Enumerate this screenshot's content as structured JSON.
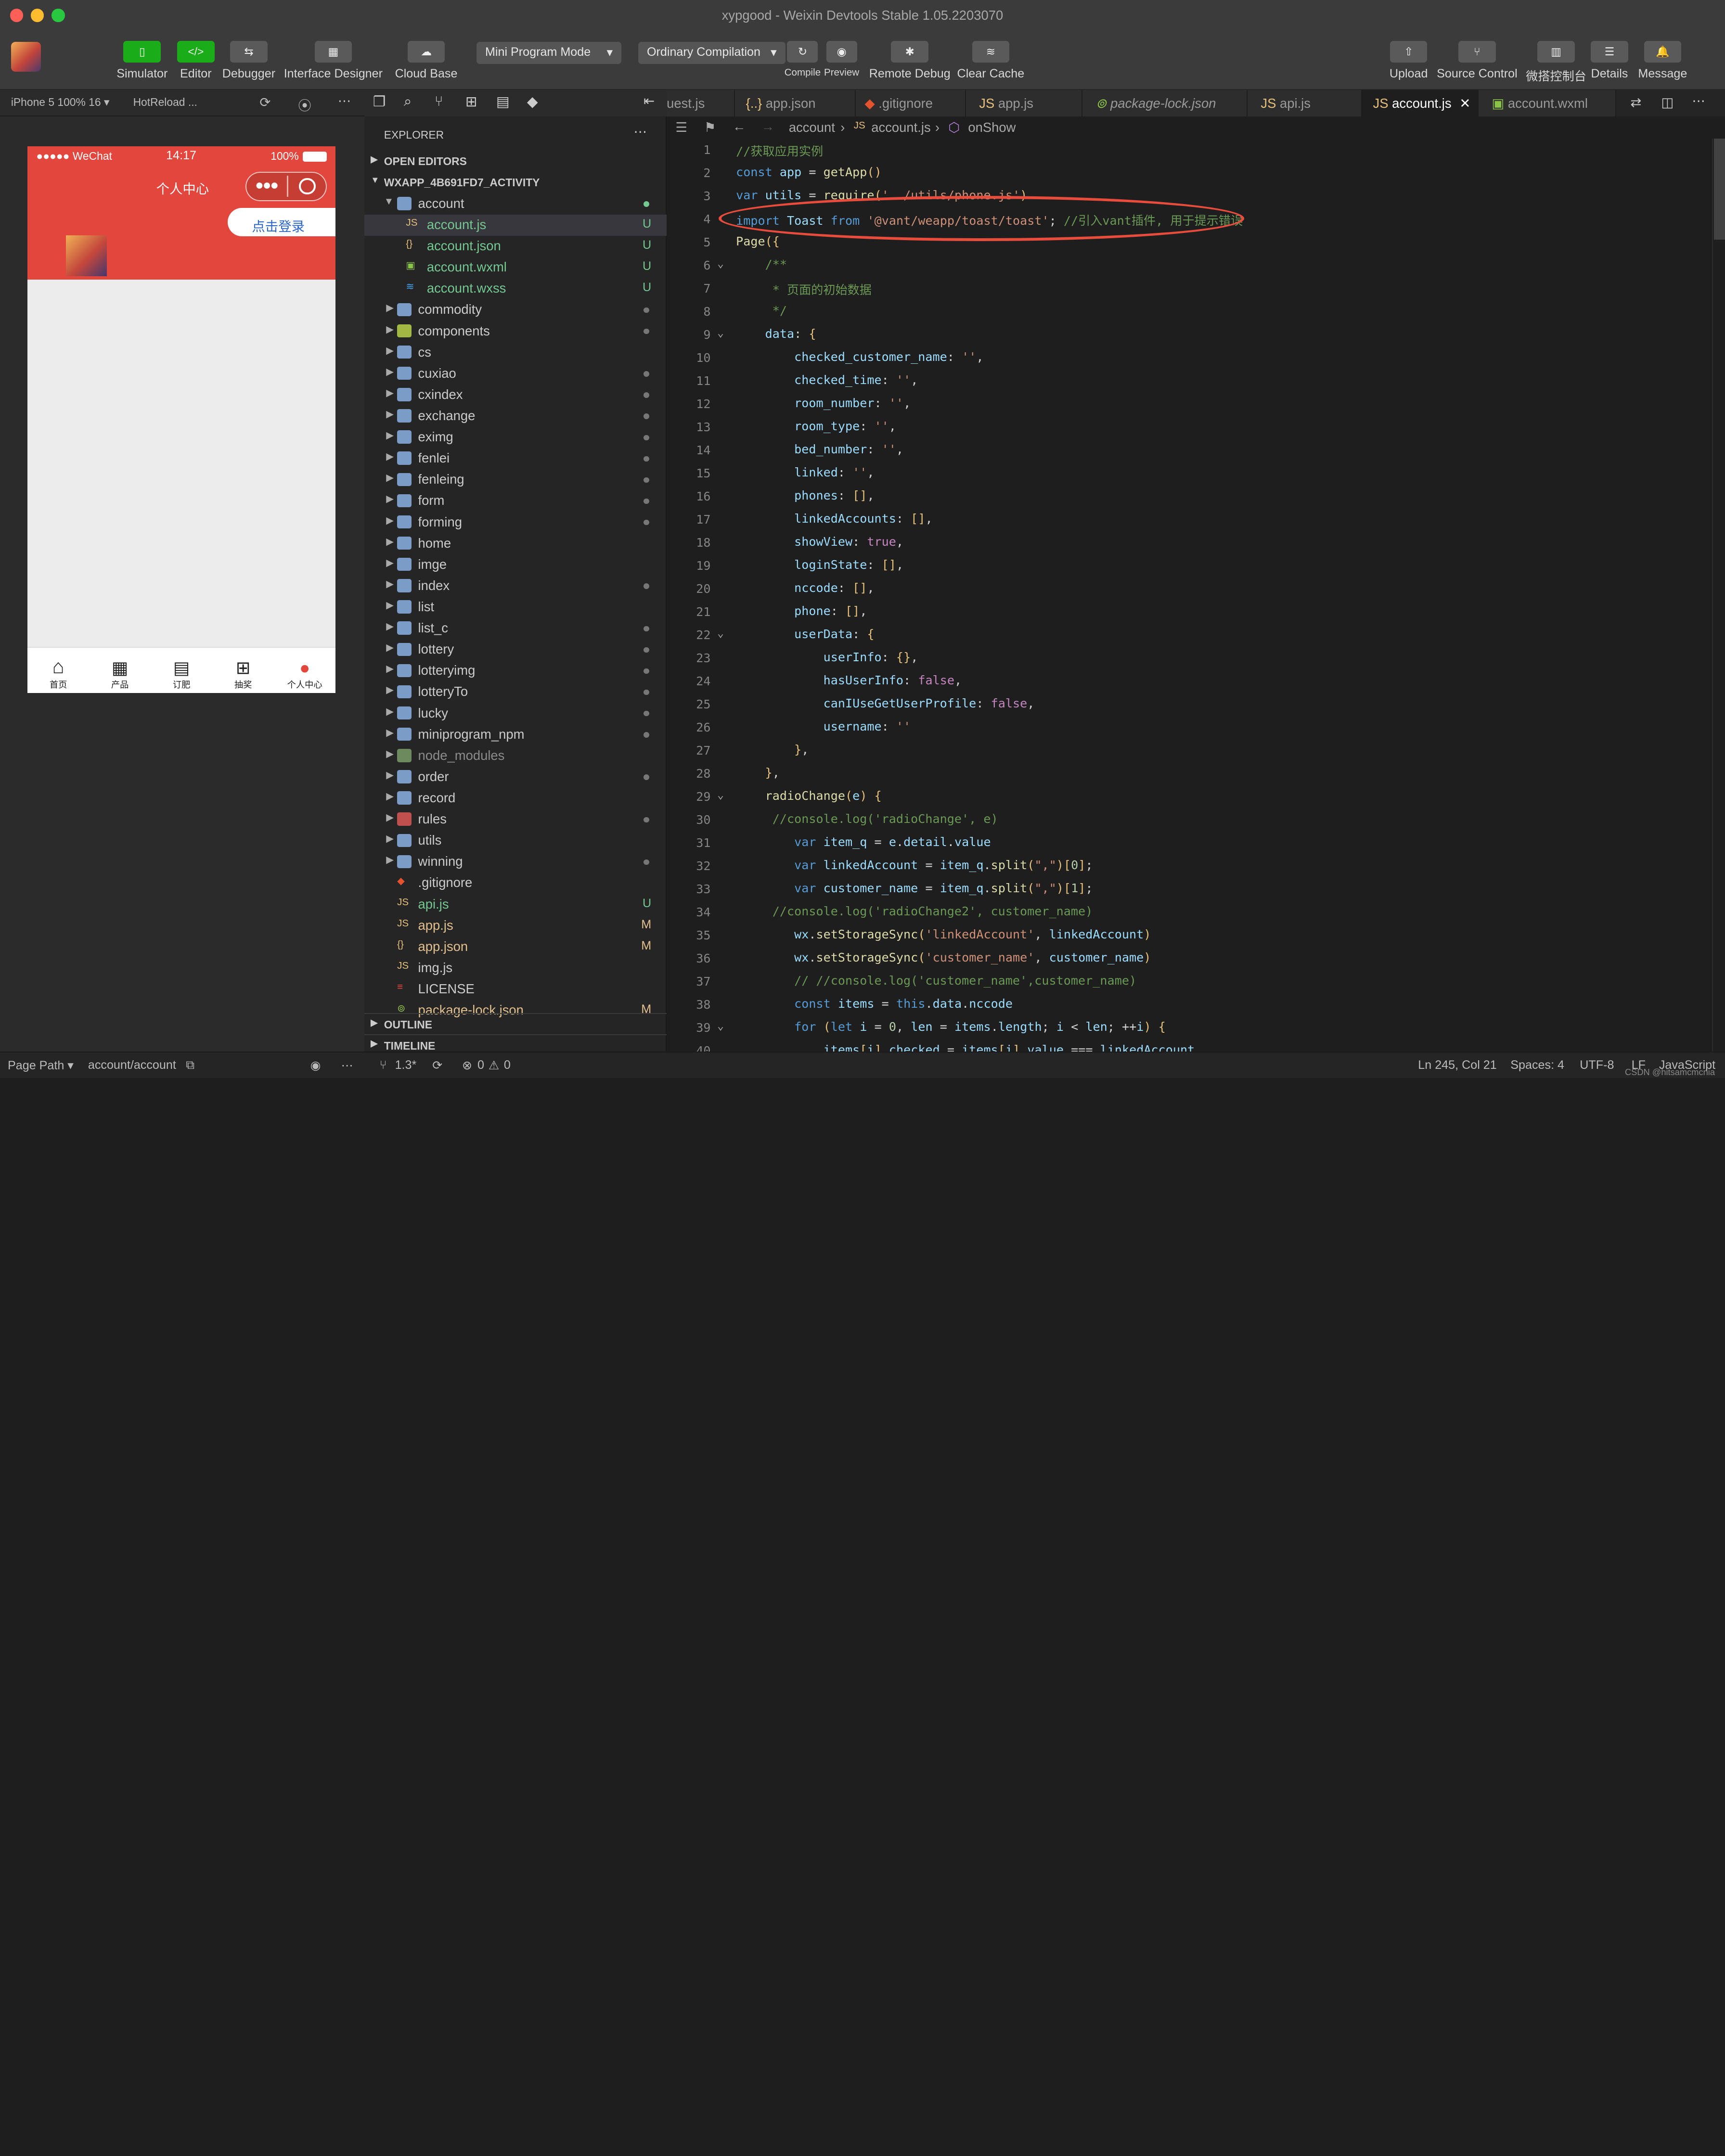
{
  "window": {
    "title": "xypgood - Weixin Devtools Stable 1.05.2203070"
  },
  "toolbar": {
    "simulator": "Simulator",
    "editor": "Editor",
    "debugger": "Debugger",
    "interface_designer": "Interface Designer",
    "cloud_base": "Cloud Base",
    "mode": "Mini Program Mode",
    "compile_mode": "Ordinary Compilation",
    "compile": "Compile",
    "preview": "Preview",
    "remote_debug": "Remote Debug",
    "clear_cache": "Clear Cache",
    "upload": "Upload",
    "source_control": "Source Control",
    "wechat_console": "微搭控制台",
    "details": "Details",
    "message": "Message"
  },
  "simulator": {
    "device": "iPhone 5 100% 16 ▾",
    "hotreload": "HotReload ...",
    "status_carrier": "●●●●● WeChat",
    "status_time": "14:17",
    "status_battery": "100%",
    "nav_title": "个人中心",
    "login_button": "点击登录",
    "tabs": [
      {
        "label": "首页"
      },
      {
        "label": "产品"
      },
      {
        "label": "订肥"
      },
      {
        "label": "抽奖"
      },
      {
        "label": "个人中心"
      }
    ]
  },
  "explorer": {
    "title": "EXPLORER",
    "open_editors": "OPEN EDITORS",
    "project": "WXAPP_4B691FD7_ACTIVITY",
    "items": [
      {
        "name": "account",
        "status": ""
      },
      {
        "name": "account.js",
        "status": "U"
      },
      {
        "name": "account.json",
        "status": "U"
      },
      {
        "name": "account.wxml",
        "status": "U"
      },
      {
        "name": "account.wxss",
        "status": "U"
      },
      {
        "name": "commodity",
        "status": ""
      },
      {
        "name": "components",
        "status": ""
      },
      {
        "name": "cs",
        "status": ""
      },
      {
        "name": "cuxiao",
        "status": ""
      },
      {
        "name": "cxindex",
        "status": ""
      },
      {
        "name": "exchange",
        "status": ""
      },
      {
        "name": "eximg",
        "status": ""
      },
      {
        "name": "fenlei",
        "status": ""
      },
      {
        "name": "fenleing",
        "status": ""
      },
      {
        "name": "form",
        "status": ""
      },
      {
        "name": "forming",
        "status": ""
      },
      {
        "name": "home",
        "status": ""
      },
      {
        "name": "imge",
        "status": ""
      },
      {
        "name": "index",
        "status": ""
      },
      {
        "name": "list",
        "status": ""
      },
      {
        "name": "list_c",
        "status": ""
      },
      {
        "name": "lottery",
        "status": ""
      },
      {
        "name": "lotteryimg",
        "status": ""
      },
      {
        "name": "lotteryTo",
        "status": ""
      },
      {
        "name": "lucky",
        "status": ""
      },
      {
        "name": "miniprogram_npm",
        "status": ""
      },
      {
        "name": "node_modules",
        "status": ""
      },
      {
        "name": "order",
        "status": ""
      },
      {
        "name": "record",
        "status": ""
      },
      {
        "name": "rules",
        "status": ""
      },
      {
        "name": "utils",
        "status": ""
      },
      {
        "name": "winning",
        "status": ""
      },
      {
        "name": ".gitignore",
        "status": ""
      },
      {
        "name": "api.js",
        "status": "U"
      },
      {
        "name": "app.js",
        "status": "M"
      },
      {
        "name": "app.json",
        "status": "M"
      },
      {
        "name": "img.js",
        "status": ""
      },
      {
        "name": "LICENSE",
        "status": ""
      },
      {
        "name": "package-lock.json",
        "status": "M"
      }
    ],
    "outline": "OUTLINE",
    "timeline": "TIMELINE"
  },
  "tabs": [
    {
      "label": "uest.js"
    },
    {
      "label": "app.json"
    },
    {
      "label": ".gitignore"
    },
    {
      "label": "app.js"
    },
    {
      "label": "package-lock.json"
    },
    {
      "label": "api.js"
    },
    {
      "label": "account.js"
    },
    {
      "label": "account.wxml"
    }
  ],
  "breadcrumb": {
    "folder": "account",
    "file": "account.js",
    "symbol": "onShow"
  },
  "code_lines": [
    "//获取应用实例",
    "const app = getApp()",
    "var utils = require('../utils/phone.js')",
    "import Toast from '@vant/weapp/toast/toast'; //引入vant插件, 用于提示错误",
    "Page({",
    "    /**",
    "     * 页面的初始数据",
    "     */",
    "    data: {",
    "        checked_customer_name: '',",
    "        checked_time: '',",
    "        room_number: '',",
    "        room_type: '',",
    "        bed_number: '',",
    "        linked: '',",
    "        phones: [],",
    "        linkedAccounts: [],",
    "        showView: true,",
    "        loginState: [],",
    "        nccode: [],",
    "        phone: [],",
    "        userData: {",
    "            userInfo: {},",
    "            hasUserInfo: false,",
    "            canIUseGetUserProfile: false,",
    "            username: ''",
    "        },",
    "    },",
    "    radioChange(e) {",
    "     //console.log('radioChange', e)",
    "        var item_q = e.detail.value",
    "        var linkedAccount = item_q.split(\",\")[0];",
    "        var customer_name = item_q.split(\",\")[1];",
    "     //console.log('radioChange2', customer_name)",
    "        wx.setStorageSync('linkedAccount', linkedAccount)",
    "        wx.setStorageSync('customer_name', customer_name)",
    "        // //console.log('customer_name',customer_name)",
    "        const items = this.data.nccode",
    "        for (let i = 0, len = items.length; i < len; ++i) {",
    "            items[i].checked = items[i].value === linkedAccount"
  ],
  "status": {
    "page_path_label": "Page Path ▾",
    "page_path": "account/account",
    "branch": "1.3*",
    "problems": "0",
    "warnings": "0",
    "position": "Ln 245, Col 21",
    "spaces": "Spaces: 4",
    "encoding": "UTF-8",
    "eol": "LF",
    "language": "JavaScript",
    "watermark": "CSDN @hitsamcmcnia"
  },
  "colors": {
    "accent_red": "#e2463c",
    "highlight_circle": "#e74c3c",
    "wechat_green": "#1aad19"
  }
}
